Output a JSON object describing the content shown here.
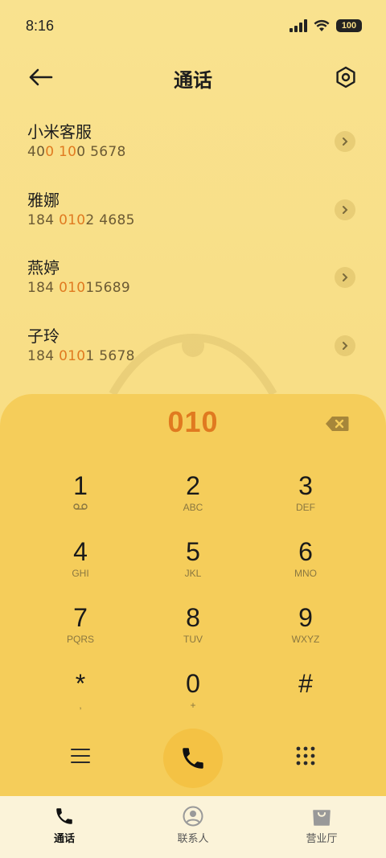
{
  "status_bar": {
    "time": "8:16",
    "battery": "100"
  },
  "header": {
    "title": "通话"
  },
  "contacts": [
    {
      "name": "小米客服",
      "number_parts": [
        "40",
        "0 10",
        "0 5678"
      ]
    },
    {
      "name": "雅娜",
      "number_parts": [
        "184 ",
        "010",
        "2 4685"
      ]
    },
    {
      "name": "燕婷",
      "number_parts": [
        "184 ",
        "010",
        "15689"
      ]
    },
    {
      "name": "子玲",
      "number_parts": [
        "184 ",
        "010",
        "1 5678"
      ]
    }
  ],
  "dialpad": {
    "dialed_number": "010",
    "keys": [
      {
        "digit": "1",
        "sub": ""
      },
      {
        "digit": "2",
        "sub": "ABC"
      },
      {
        "digit": "3",
        "sub": "DEF"
      },
      {
        "digit": "4",
        "sub": "GHI"
      },
      {
        "digit": "5",
        "sub": "JKL"
      },
      {
        "digit": "6",
        "sub": "MNO"
      },
      {
        "digit": "7",
        "sub": "PQRS"
      },
      {
        "digit": "8",
        "sub": "TUV"
      },
      {
        "digit": "9",
        "sub": "WXYZ"
      },
      {
        "digit": "*",
        "sub": ","
      },
      {
        "digit": "0",
        "sub": "+"
      },
      {
        "digit": "#",
        "sub": ""
      }
    ]
  },
  "bottom_nav": [
    {
      "label": "通话",
      "icon": "phone-icon",
      "active": true
    },
    {
      "label": "联系人",
      "icon": "contact-icon",
      "active": false
    },
    {
      "label": "营业厅",
      "icon": "shopping-bag-icon",
      "active": false
    }
  ],
  "colors": {
    "accent": "#e07a20",
    "panel": "#f5cd5a",
    "background": "#f8de86",
    "nav_bg": "#fbf3d9"
  }
}
